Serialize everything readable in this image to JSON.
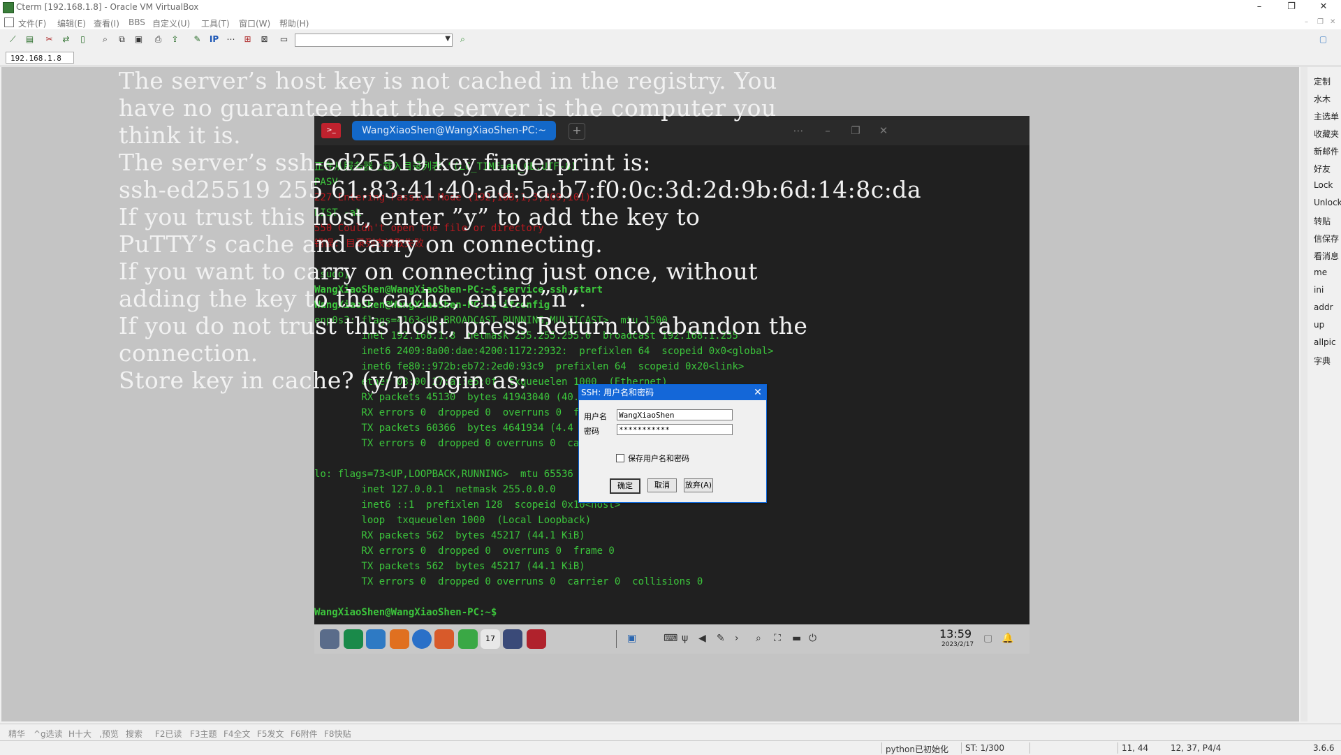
{
  "window": {
    "title": "Cterm [192.168.1.8] - Oracle VM VirtualBox",
    "minimize": "–",
    "maximize": "❐",
    "close": "✕"
  },
  "menu": [
    "文件(F)",
    "编辑(E)",
    "查看(I)",
    "BBS",
    "自定义(U)",
    "工具(T)",
    "窗口(W)",
    "帮助(H)"
  ],
  "toolbar": {
    "ip_label": "IP",
    "combo_value": ""
  },
  "address_tab": "192.168.1.8",
  "vm_terminal": {
    "tab_title": "WangXiaoShen@WangXiaoShen-PC:~",
    "lines": [
      {
        "cls": "g",
        "text": "正在从服务器上载入目录列表 \"(LC_TIME=en_GB.UTF-8)"
      },
      {
        "cls": "g",
        "text": "PASV"
      },
      {
        "cls": "r",
        "text": "227 Entering Passive Mode (192,168,1,3,209,101)"
      },
      {
        "cls": "g",
        "text": "LIST -aL"
      },
      {
        "cls": "r",
        "text": "550 Couldn't open the file or directory"
      },
      {
        "cls": "r",
        "text": "错误: 目录列表读取失败"
      },
      {
        "cls": "g",
        "text": ""
      },
      {
        "cls": "g",
        "text": "[sudo] "
      },
      {
        "cls": "pr",
        "text": "WangXiaoShen@WangXiaoShen-PC:~$ service ssh start"
      },
      {
        "cls": "pr",
        "text": "WangXiaoShen@WangXiaoShen-PC:~$ ifconfig"
      },
      {
        "cls": "g",
        "text": "enp0s3: flags=4163<UP,BROADCAST,RUNNING,MULTICAST>  mtu 1500"
      },
      {
        "cls": "g",
        "text": "        inet 192.168.1.8  netmask 255.255.255.0  broadcast 192.168.1.255"
      },
      {
        "cls": "g",
        "text": "        inet6 2409:8a00:dae:4200:1172:2932:  prefixlen 64  scopeid 0x0<global>"
      },
      {
        "cls": "g",
        "text": "        inet6 fe80::972b:eb72:2ed0:93c9  prefixlen 64  scopeid 0x20<link>"
      },
      {
        "cls": "g",
        "text": "        ether 08:00:27:a1:e5:0f  txqueuelen 1000  (Ethernet)"
      },
      {
        "cls": "g",
        "text": "        RX packets 45130  bytes 41943040 (40.0 MiB)"
      },
      {
        "cls": "g",
        "text": "        RX errors 0  dropped 0  overruns 0  frame 0"
      },
      {
        "cls": "g",
        "text": "        TX packets 60366  bytes 4641934 (4.4 MiB)"
      },
      {
        "cls": "g",
        "text": "        TX errors 0  dropped 0 overruns 0  carrier 0  collisions 0"
      },
      {
        "cls": "g",
        "text": ""
      },
      {
        "cls": "g",
        "text": "lo: flags=73<UP,LOOPBACK,RUNNING>  mtu 65536"
      },
      {
        "cls": "g",
        "text": "        inet 127.0.0.1  netmask 255.0.0.0"
      },
      {
        "cls": "g",
        "text": "        inet6 ::1  prefixlen 128  scopeid 0x10<host>"
      },
      {
        "cls": "g",
        "text": "        loop  txqueuelen 1000  (Local Loopback)"
      },
      {
        "cls": "g",
        "text": "        RX packets 562  bytes 45217 (44.1 KiB)"
      },
      {
        "cls": "g",
        "text": "        RX errors 0  dropped 0  overruns 0  frame 0"
      },
      {
        "cls": "g",
        "text": "        TX packets 562  bytes 45217 (44.1 KiB)"
      },
      {
        "cls": "g",
        "text": "        TX errors 0  dropped 0 overruns 0  carrier 0  collisions 0"
      },
      {
        "cls": "g",
        "text": ""
      },
      {
        "cls": "pr",
        "text": "WangXiaoShen@WangXiaoShen-PC:~$"
      }
    ],
    "clock": "13:59",
    "date": "2023/2/17"
  },
  "putty_message": "The server’s host key is not cached in the registry. You\nhave no guarantee that the server is the computer you\nthink it is.\nThe server’s ssh-ed25519 key fingerprint is:\nssh-ed25519 255 61:83:41:40:ad:5a:b7:f0:0c:3d:2d:9b:6d:14:8c:da\nIf you trust this host, enter ”y” to add the key to\nPuTTY’s cache and carry on connecting.\nIf you want to carry on connecting just once, without\nadding the key to the cache, enter ”n”.\nIf you do not trust this host, press Return to abandon the\nconnection.\nStore key in cache? (y/n) login as:",
  "dialog": {
    "title": "SSH: 用户名和密码",
    "username_label": "用户名",
    "username_value": "WangXiaoShen",
    "password_label": "密码",
    "password_value": "***********",
    "save_label": "保存用户名和密码",
    "ok": "确定",
    "cancel": "取消",
    "abandon": "放弃(A)"
  },
  "sidebar": [
    "定制",
    "水木",
    "主选单",
    "收藏夹",
    "新邮件",
    "好友",
    "Lock",
    "Unlock",
    "转贴",
    "信保存",
    "看消息",
    "me",
    "ini",
    "addr",
    "up",
    "allpic",
    "字典"
  ],
  "fn_keys": [
    "精华",
    "^g选读",
    "H十大",
    ",预览",
    "搜索",
    "F2已读",
    "F3主题",
    "F4全文",
    "F5发文",
    "F6附件",
    "F8快贴"
  ],
  "status": {
    "python": "python已初始化",
    "st": "ST: 1/300",
    "pos": "11, 44",
    "page": "12, 37, P4/4",
    "misc": "3.6.6"
  }
}
